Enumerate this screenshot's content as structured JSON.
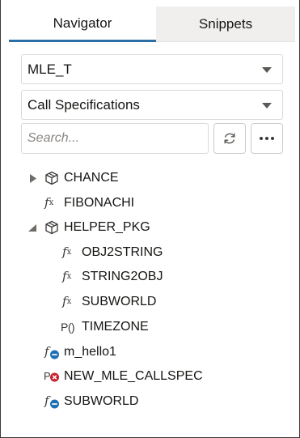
{
  "tabs": [
    {
      "label": "Navigator",
      "active": true
    },
    {
      "label": "Snippets",
      "active": false
    }
  ],
  "schema_select": {
    "value": "MLE_T"
  },
  "type_select": {
    "value": "Call Specifications"
  },
  "search": {
    "placeholder": "Search...",
    "value": ""
  },
  "toolbar": {
    "refresh_icon": "refresh-icon",
    "more_icon": "ellipsis-icon"
  },
  "tree": {
    "items": [
      {
        "label": "CHANCE",
        "icon": "package-cube-icon",
        "expandable": true,
        "expanded": false
      },
      {
        "label": "FIBONACHI",
        "icon": "function-fx-icon"
      },
      {
        "label": "HELPER_PKG",
        "icon": "package-cube-icon",
        "expandable": true,
        "expanded": true
      },
      {
        "label": "OBJ2STRING",
        "icon": "function-fx-icon"
      },
      {
        "label": "STRING2OBJ",
        "icon": "function-fx-icon"
      },
      {
        "label": "SUBWORLD",
        "icon": "function-fx-icon"
      },
      {
        "label": "TIMEZONE",
        "icon": "procedure-icon"
      },
      {
        "label": "m_hello1",
        "icon": "function-blue-badge-icon"
      },
      {
        "label": "NEW_MLE_CALLSPEC",
        "icon": "procedure-error-icon"
      },
      {
        "label": "SUBWORLD",
        "icon": "function-blue-badge-icon"
      }
    ]
  },
  "colors": {
    "accent": "#2b6fa6",
    "badge_blue": "#1f6fb5",
    "error_red": "#c8202d"
  }
}
